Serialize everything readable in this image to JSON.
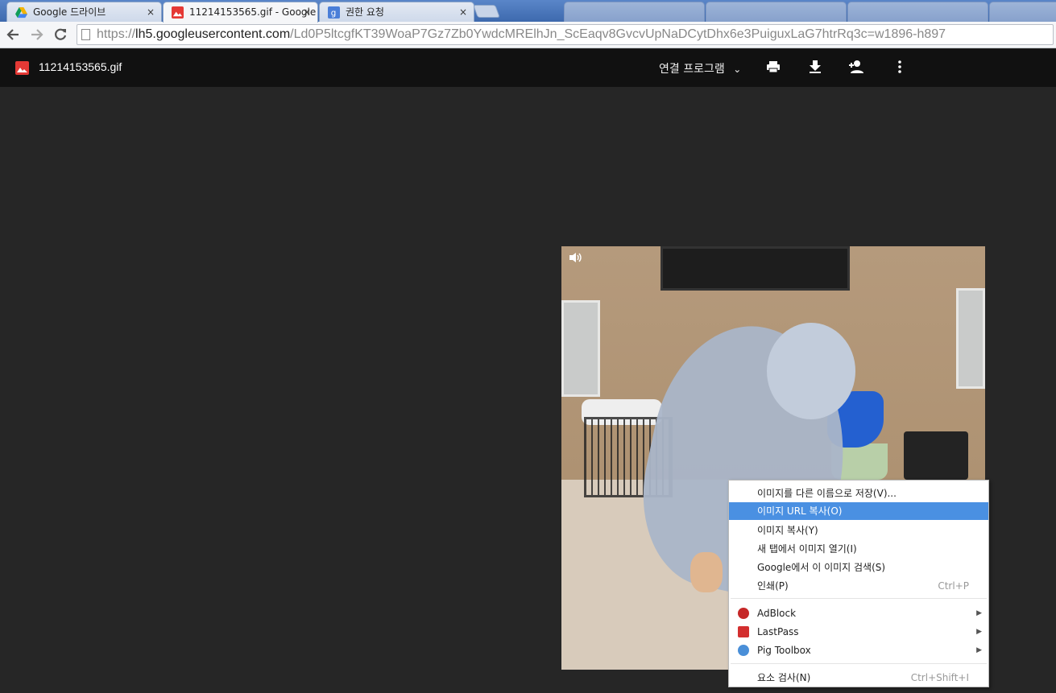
{
  "tabs": [
    {
      "title": "Google 드라이브",
      "close": "×"
    },
    {
      "title": "11214153565.gif - Google",
      "close": "×"
    },
    {
      "title": "권한 요청",
      "close": "×"
    }
  ],
  "address_bar": {
    "scheme": "https://",
    "host": "lh5.googleusercontent.com",
    "path": "/Ld0P5ltcgfKT39WoaP7Gz7Zb0YwdcMRElhJn_ScEaqv8GvcvUpNaDCytDhx6e3PuiguxLaG7htrRq3c=w1896-h897"
  },
  "viewer": {
    "file_name": "11214153565.gif",
    "open_with": "연결 프로그램",
    "open_with_caret": "⌄",
    "icons": [
      "print-icon",
      "download-icon",
      "add-person-icon",
      "more-vert-icon"
    ]
  },
  "context_menu": {
    "items": [
      {
        "label": "이미지를 다른 이름으로 저장(V)..."
      },
      {
        "label": "이미지 URL 복사(O)",
        "highlighted": true
      },
      {
        "label": "이미지 복사(Y)"
      },
      {
        "label": "새 탭에서 이미지 열기(I)"
      },
      {
        "label": "Google에서 이 이미지 검색(S)"
      },
      {
        "label": "인쇄(P)",
        "shortcut": "Ctrl+P"
      }
    ],
    "extensions": [
      {
        "label": "AdBlock",
        "icon": "adblock-icon",
        "color": "#c62828"
      },
      {
        "label": "LastPass",
        "icon": "lastpass-icon",
        "color": "#d32f2f"
      },
      {
        "label": "Pig Toolbox",
        "icon": "pig-toolbox-icon",
        "color": "#4a8fd8"
      }
    ],
    "inspect": {
      "label": "요소 검사(N)",
      "shortcut": "Ctrl+Shift+I"
    },
    "submenu_arrow": "▶"
  },
  "colors": {
    "highlight": "#4a90e2",
    "viewer_bg": "#262626",
    "header_bg": "#111111",
    "image_icon": "#e53935"
  }
}
